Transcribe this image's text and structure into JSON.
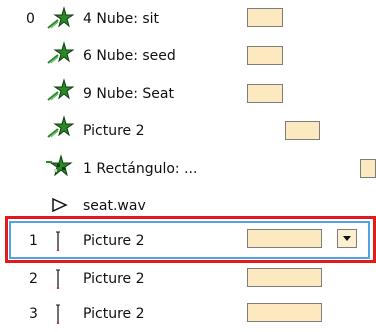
{
  "rows": [
    {
      "index": "0",
      "label": "4 Nube: sit"
    },
    {
      "label": "6 Nube: seed"
    },
    {
      "label": "9 Nube: Seat"
    },
    {
      "label": "Picture 2"
    },
    {
      "label": "1 Rectángulo: ..."
    },
    {
      "label": "seat.wav"
    },
    {
      "index": "1",
      "label": "Picture 2"
    },
    {
      "index": "2",
      "label": "Picture 2"
    },
    {
      "index": "3",
      "label": "Picture 2"
    }
  ],
  "icons": {
    "entrance_star": "green-star-motion-icon",
    "entrance_checker": "checkered-star-icon",
    "sound": "play-triangle-icon",
    "line": "line-path-icon",
    "dropdown": "chevron-down-icon"
  },
  "colors": {
    "timeline_bar": "#fde9bf",
    "selection": "#4fa3e6",
    "highlight": "#e3191c",
    "star_green": "#2a7a2a"
  }
}
